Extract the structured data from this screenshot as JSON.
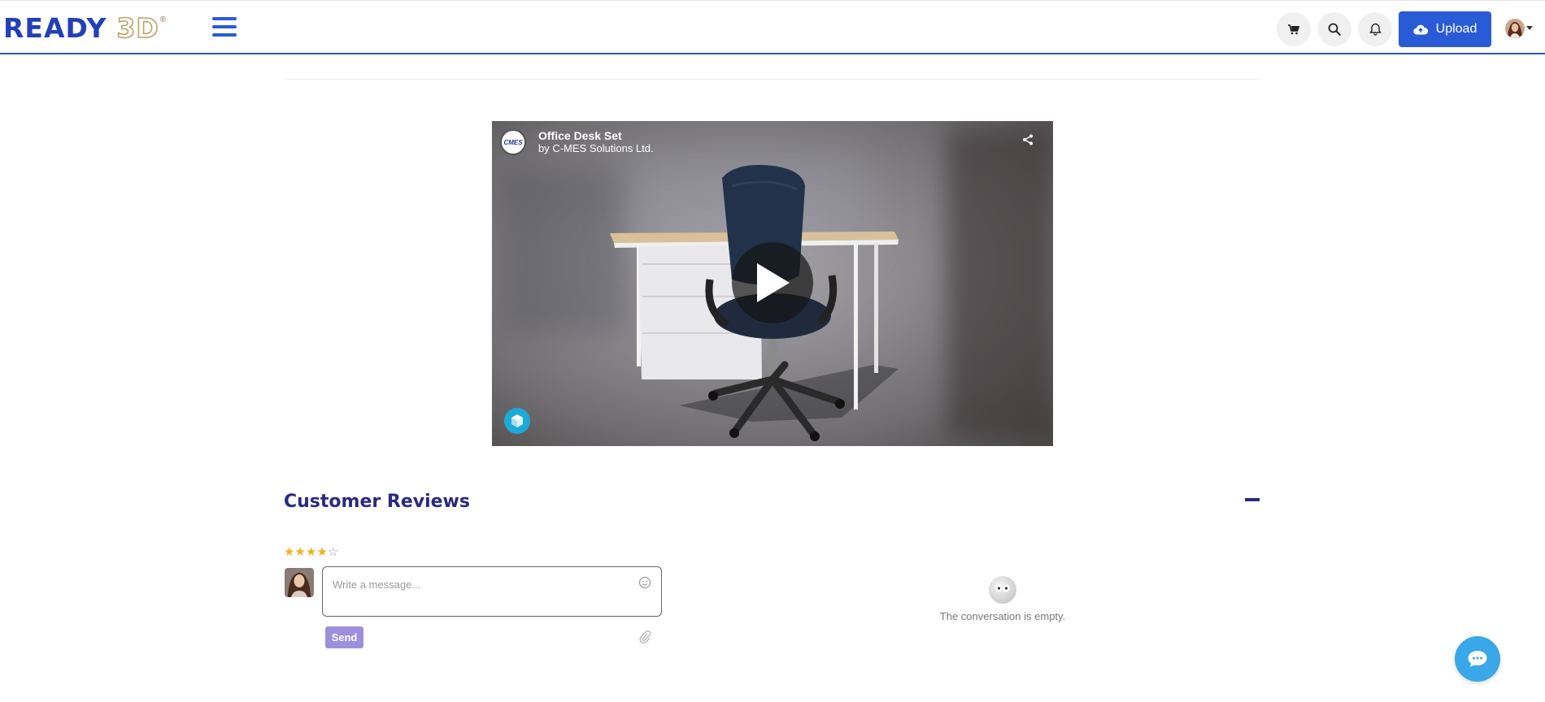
{
  "header": {
    "logo_main": "READY",
    "logo_accent": "3D",
    "logo_mark": "®",
    "upload_label": "Upload",
    "icons": [
      "menu-icon",
      "cart-icon",
      "search-icon",
      "bell-icon",
      "cloud-upload-icon",
      "avatar",
      "caret-down-icon"
    ],
    "accent_color": "#2a5bd7"
  },
  "viewer": {
    "title": "Office Desk Set",
    "byline": "by C-MES Solutions Ltd.",
    "publisher_logo_text": "CMES",
    "icons": [
      "share-icon",
      "play-icon",
      "sketchfab-icon"
    ]
  },
  "reviews": {
    "title": "Customer Reviews",
    "rating": 4,
    "rating_max": 5,
    "message_placeholder": "Write a message...",
    "send_label": "Send",
    "empty_text": "The conversation is empty.",
    "icons": [
      "minus-icon",
      "emoji-icon",
      "paperclip-icon",
      "chat-icon"
    ],
    "title_color": "#2b2a80",
    "star_color": "#f2b01e"
  }
}
